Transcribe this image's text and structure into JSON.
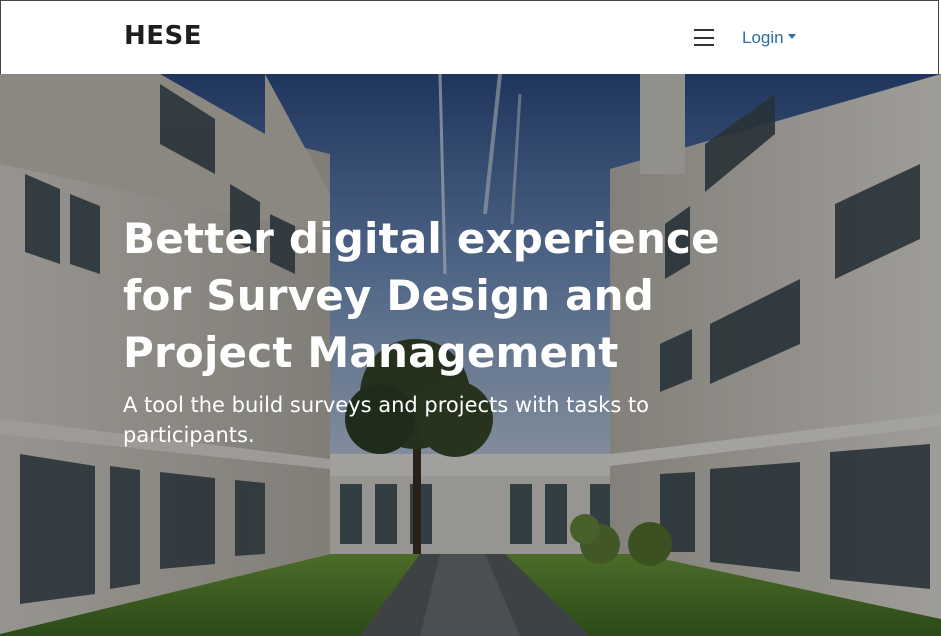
{
  "navbar": {
    "brand": "HESE",
    "menu_icon": "hamburger-menu-icon",
    "login_label": "Login",
    "login_icon": "caret-down-icon"
  },
  "hero": {
    "headline": "Better digital experience for Survey Design and Project Management",
    "subline": "A tool the build surveys and projects with tasks to participants.",
    "background": "courtyard-photo"
  },
  "colors": {
    "link": "#2e6da4",
    "brand_text": "#1e1e1e",
    "hero_text": "#ffffff"
  }
}
